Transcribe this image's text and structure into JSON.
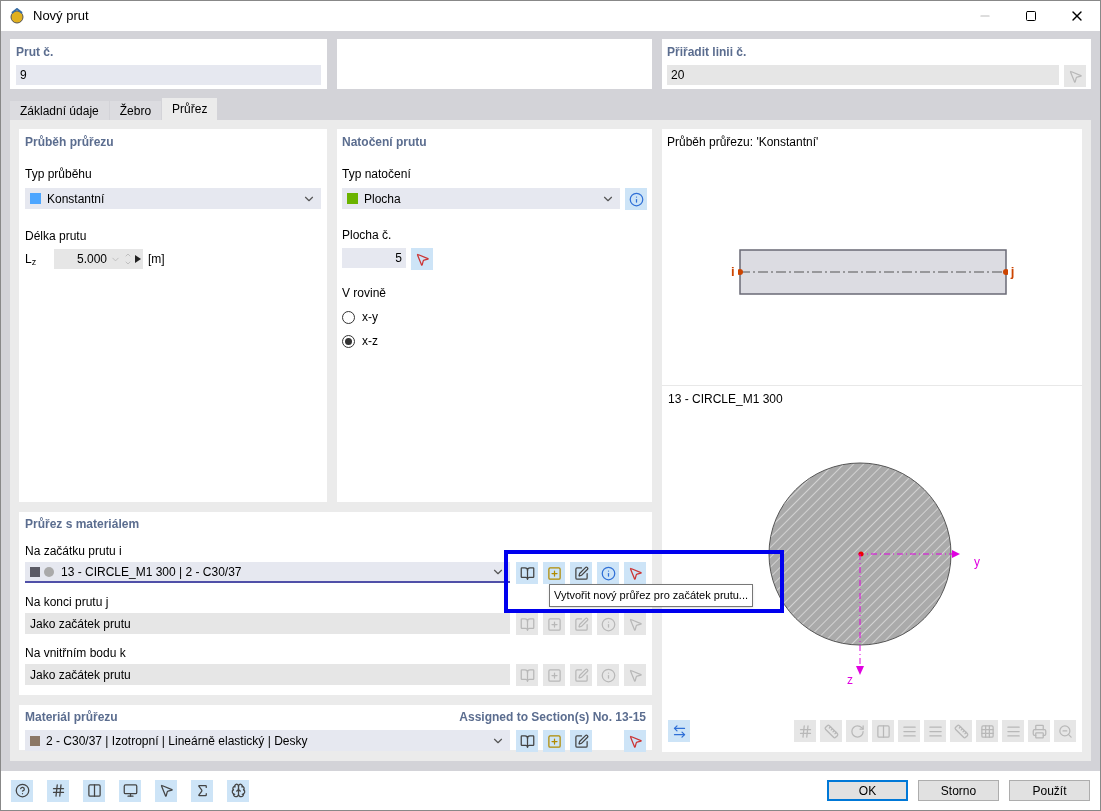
{
  "window": {
    "title": "Nový prut"
  },
  "member_no": {
    "label": "Prut č.",
    "value": "9"
  },
  "assign_line": {
    "label": "Přiřadit linii č.",
    "value": "20"
  },
  "tabs": [
    {
      "label": "Základní údaje",
      "selected": false
    },
    {
      "label": "Žebro",
      "selected": false
    },
    {
      "label": "Průřez",
      "selected": true
    }
  ],
  "distribution": {
    "title": "Průběh průřezu",
    "type_label": "Typ průběhu",
    "type_value": {
      "text": "Konstantní",
      "color": "#4da6ff"
    },
    "length_label": "Délka prutu",
    "length_symbol": "L$_{z}$",
    "length_value": "5.000",
    "length_unit": "[m]"
  },
  "rotation": {
    "title": "Natočení prutu",
    "type_label": "Typ natočení",
    "type_value": {
      "text": "Plocha",
      "color": "#6bb300"
    },
    "surface_label": "Plocha č.",
    "surface_value": "5",
    "plane_label": "V rovině",
    "options": [
      {
        "label": "x-y",
        "selected": false
      },
      {
        "label": "x-z",
        "selected": true
      }
    ]
  },
  "section_material": {
    "title": "Průřez s materiálem",
    "rows": [
      {
        "label": "Na začátku prutu i",
        "value": "13 - CIRCLE_M1 300 | 2 - C30/37",
        "disabled": false
      },
      {
        "label": "Na konci prutu j",
        "value": "Jako začátek prutu",
        "disabled": true
      },
      {
        "label": "Na vnitřním bodu k",
        "value": "Jako začátek prutu",
        "disabled": true
      }
    ]
  },
  "tooltip": "Vytvořit nový průřez pro začátek prutu...",
  "material": {
    "title": "Materiál průřezu",
    "assigned": "Assigned to Section(s) No. 13-15",
    "value": "2 - C30/37 | Izotropní | Lineárně elastický | Desky",
    "color": "#8b7765"
  },
  "preview": {
    "distribution_title": "Průběh průřezu: 'Konstantní'",
    "start": "i",
    "end": "j",
    "section_title": "13 - CIRCLE_M1 300",
    "axis_y": "y",
    "axis_z": "z"
  },
  "footer_buttons": [
    {
      "label": "OK",
      "default": true
    },
    {
      "label": "Storno",
      "default": false
    },
    {
      "label": "Použít",
      "default": false
    }
  ]
}
